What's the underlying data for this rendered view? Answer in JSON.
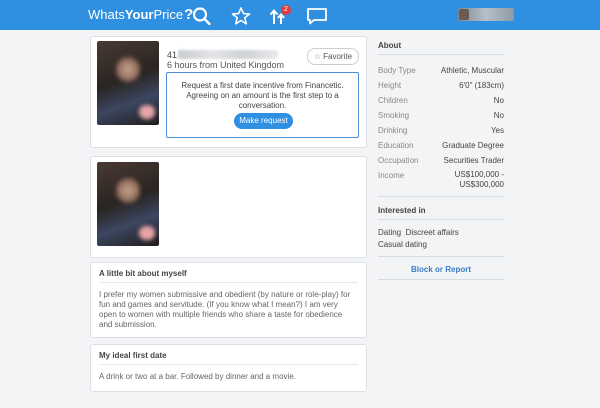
{
  "header": {
    "logo_prefix": "Whats",
    "logo_bold": "Your",
    "logo_suffix": "Price",
    "logo_mark": "?",
    "notification_count": "2",
    "colors": {
      "bar": "#2f8fe0",
      "badge": "#e23b3b"
    },
    "icons": [
      "search-icon",
      "star-icon",
      "upload-arrows-icon",
      "chat-icon"
    ]
  },
  "profile": {
    "age": "41",
    "last_seen": "6 hours from United Kingdom",
    "favorite_label": "Favorite",
    "request_text": "Request a first date incentive from Financetic. Agreeing on an amount is the first step to a conversation.",
    "request_button": "Make request"
  },
  "sections": {
    "about_myself": {
      "title": "A little bit about myself",
      "body": "I prefer my women submissive and obedient (by nature or role-play) for fun and games and servitude. (If you know what I mean?) I am very open to women with multiple friends who share a taste for obedience and submission."
    },
    "first_date": {
      "title": "My ideal first date",
      "body": "A drink or two at a bar. Followed by dinner and a movie."
    }
  },
  "sidebar": {
    "about_title": "About",
    "attributes": [
      {
        "label": "Body Type",
        "value": "Athletic, Muscular"
      },
      {
        "label": "Height",
        "value": "6'0\" (183cm)"
      },
      {
        "label": "Children",
        "value": "No"
      },
      {
        "label": "Smoking",
        "value": "No"
      },
      {
        "label": "Drinking",
        "value": "Yes"
      },
      {
        "label": "Education",
        "value": "Graduate Degree"
      },
      {
        "label": "Occupation",
        "value": "Securities Trader"
      },
      {
        "label": "Income",
        "value": "US$100,000 -",
        "value2": "US$300,000"
      }
    ],
    "interested_title": "Interested in",
    "interests": [
      {
        "label": "Dating",
        "value": "Discreet affairs"
      },
      {
        "label": "Casual dating"
      }
    ],
    "block_label": "Block or Report"
  }
}
